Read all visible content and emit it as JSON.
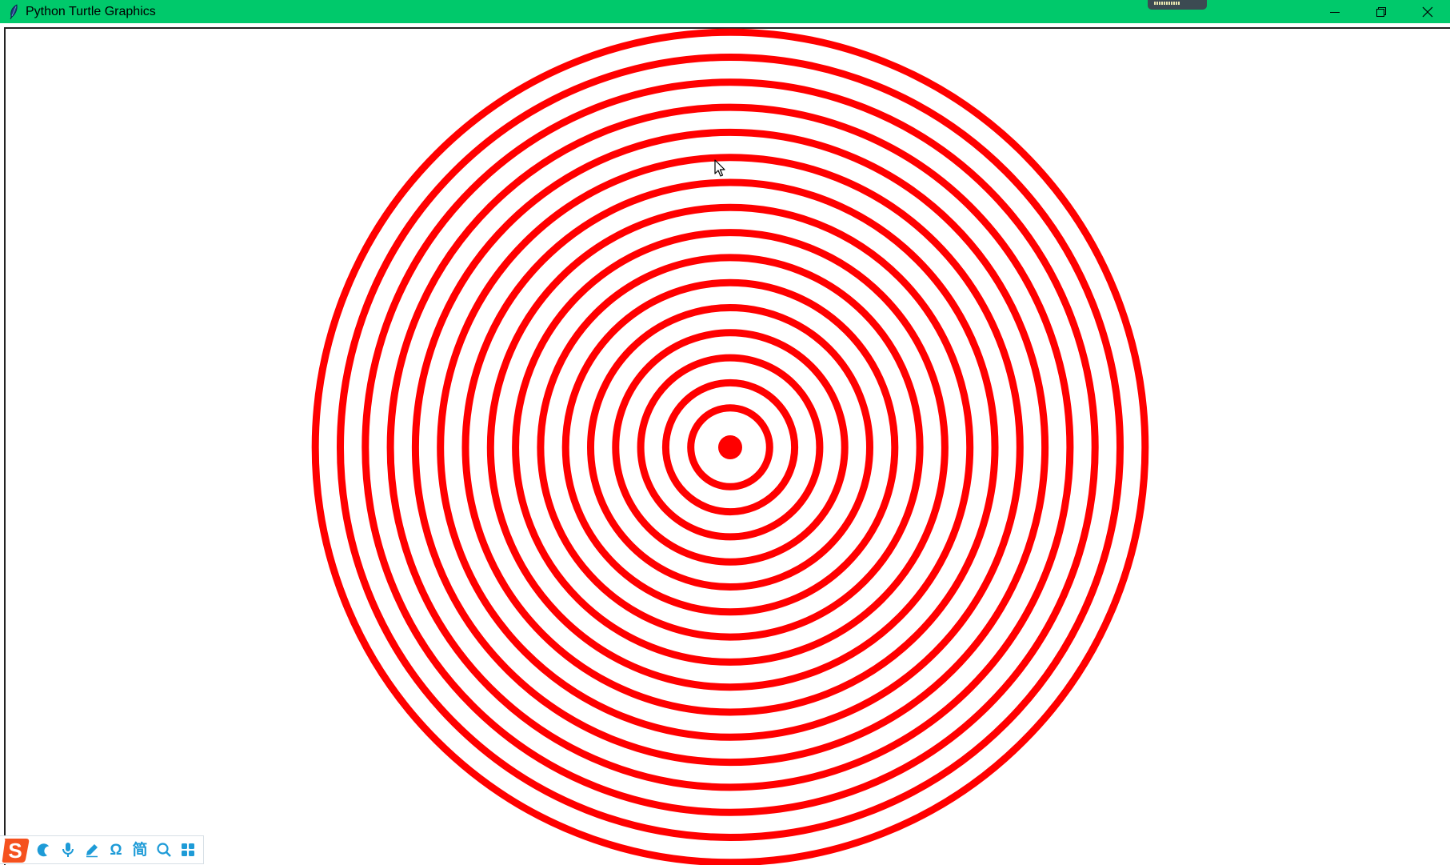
{
  "window": {
    "title": "Python Turtle Graphics",
    "titlebar_color": "#00c96b",
    "controls": [
      "minimize-icon",
      "restore-icon",
      "close-icon"
    ]
  },
  "canvas": {
    "background": "#ffffff",
    "drawing": {
      "shape": "concentric rings with center dot",
      "stroke_color": "#ff0000",
      "ring_count": 17
    }
  },
  "ime_toolbar": {
    "accent_color": "#1e9bd7",
    "logo": "S",
    "tools": [
      {
        "icon": "moon-icon"
      },
      {
        "icon": "microphone-icon"
      },
      {
        "icon": "pen-icon"
      },
      {
        "icon": "omega-icon",
        "text": "Ω"
      },
      {
        "icon": "simplified-chinese-icon",
        "text": "简"
      },
      {
        "icon": "search-icon"
      },
      {
        "icon": "grid-apps-icon"
      }
    ]
  }
}
